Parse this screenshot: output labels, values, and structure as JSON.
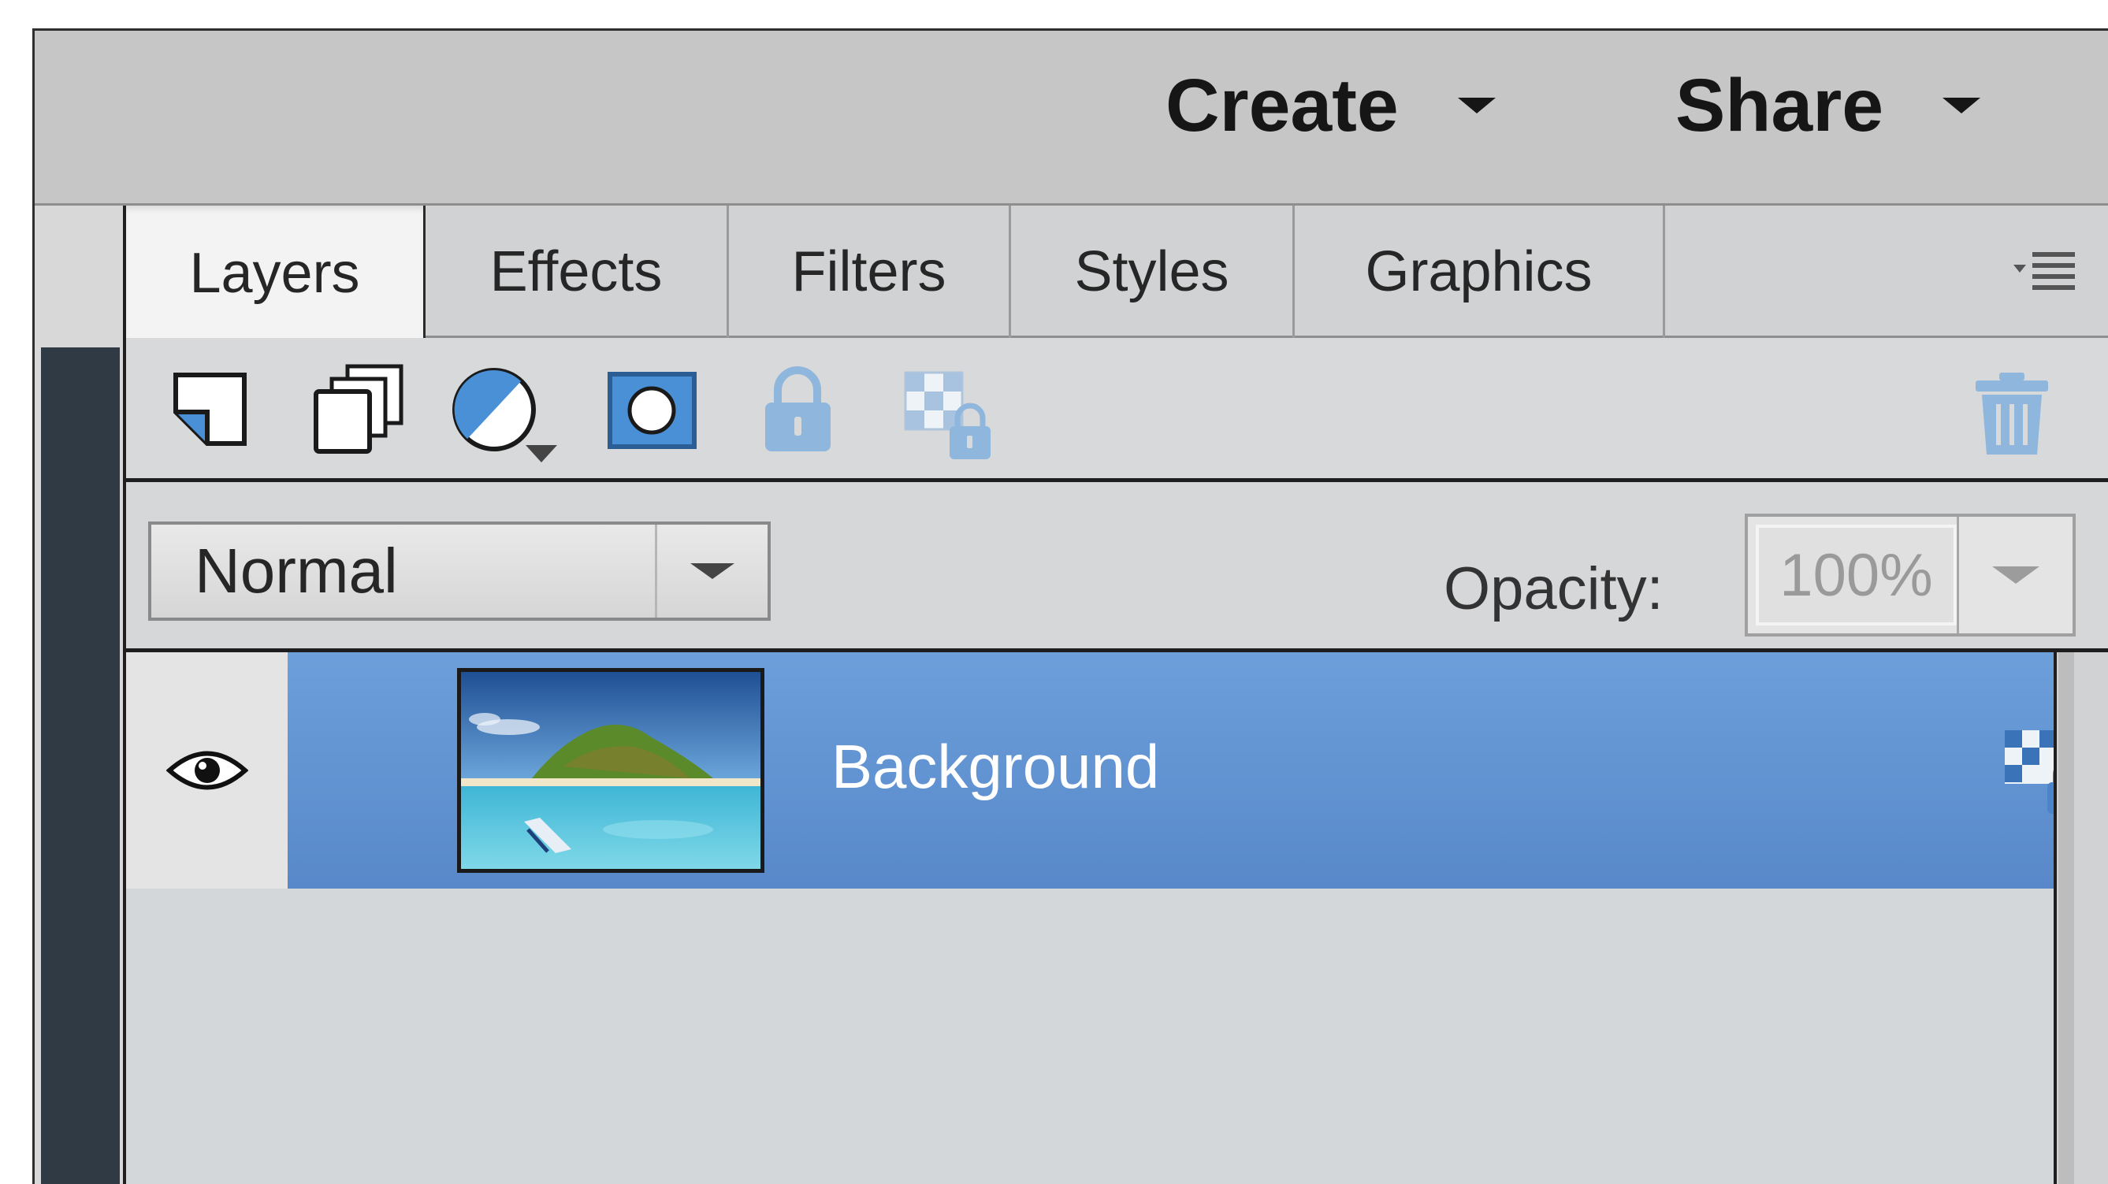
{
  "topbar": {
    "create_label": "Create",
    "share_label": "Share"
  },
  "tabs": [
    {
      "label": "Layers",
      "active": true
    },
    {
      "label": "Effects",
      "active": false
    },
    {
      "label": "Filters",
      "active": false
    },
    {
      "label": "Styles",
      "active": false
    },
    {
      "label": "Graphics",
      "active": false
    }
  ],
  "panel_menu_icon": "panel-menu-icon",
  "toolbar": {
    "icons": [
      "new-layer-icon",
      "new-group-icon",
      "adjustment-layer-icon",
      "layer-mask-icon",
      "lock-all-icon",
      "lock-transparency-icon",
      "trash-icon"
    ]
  },
  "blend": {
    "mode": "Normal",
    "opacity_label": "Opacity:",
    "opacity_value": "100%"
  },
  "layers": [
    {
      "name": "Background",
      "selected": true,
      "visible": true
    }
  ],
  "colors": {
    "selection": "#6d9fdb",
    "lock_icon": "#8fb6dc",
    "mask_icon": "#4a90d6"
  }
}
